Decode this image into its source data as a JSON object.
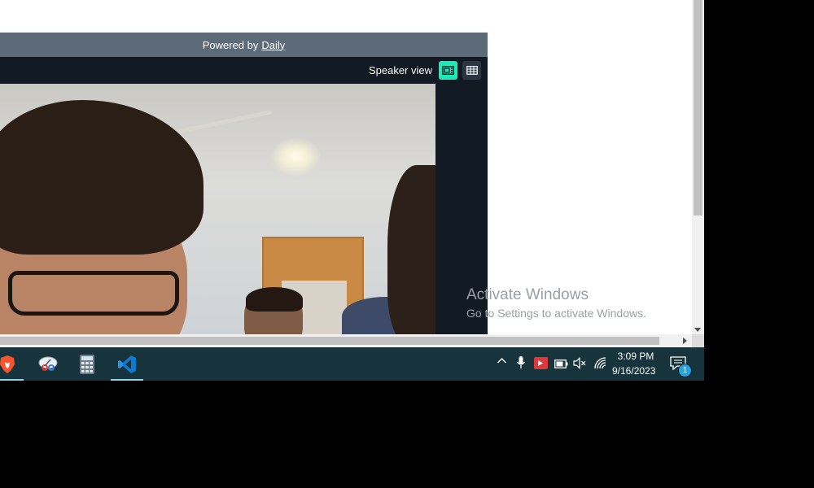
{
  "embed": {
    "powered_prefix": "Powered by",
    "powered_link": "Daily"
  },
  "call": {
    "view_label": "Speaker view",
    "accent_color": "#1bebb9"
  },
  "watermark": {
    "title": "Activate Windows",
    "subtitle": "Go to Settings to activate Windows."
  },
  "taskbar": {
    "apps": [
      {
        "name": "brave-browser-icon",
        "active": true
      },
      {
        "name": "snipping-tool-icon",
        "active": false
      },
      {
        "name": "calculator-icon",
        "active": false
      },
      {
        "name": "vscode-icon",
        "active": true
      }
    ],
    "tray_icons": [
      "chevron-up-icon",
      "microphone-icon",
      "screen-share-icon",
      "battery-icon",
      "volume-muted-icon",
      "wifi-icon"
    ],
    "clock_time": "3:09 PM",
    "clock_date": "9/16/2023",
    "notification_count": "1"
  }
}
